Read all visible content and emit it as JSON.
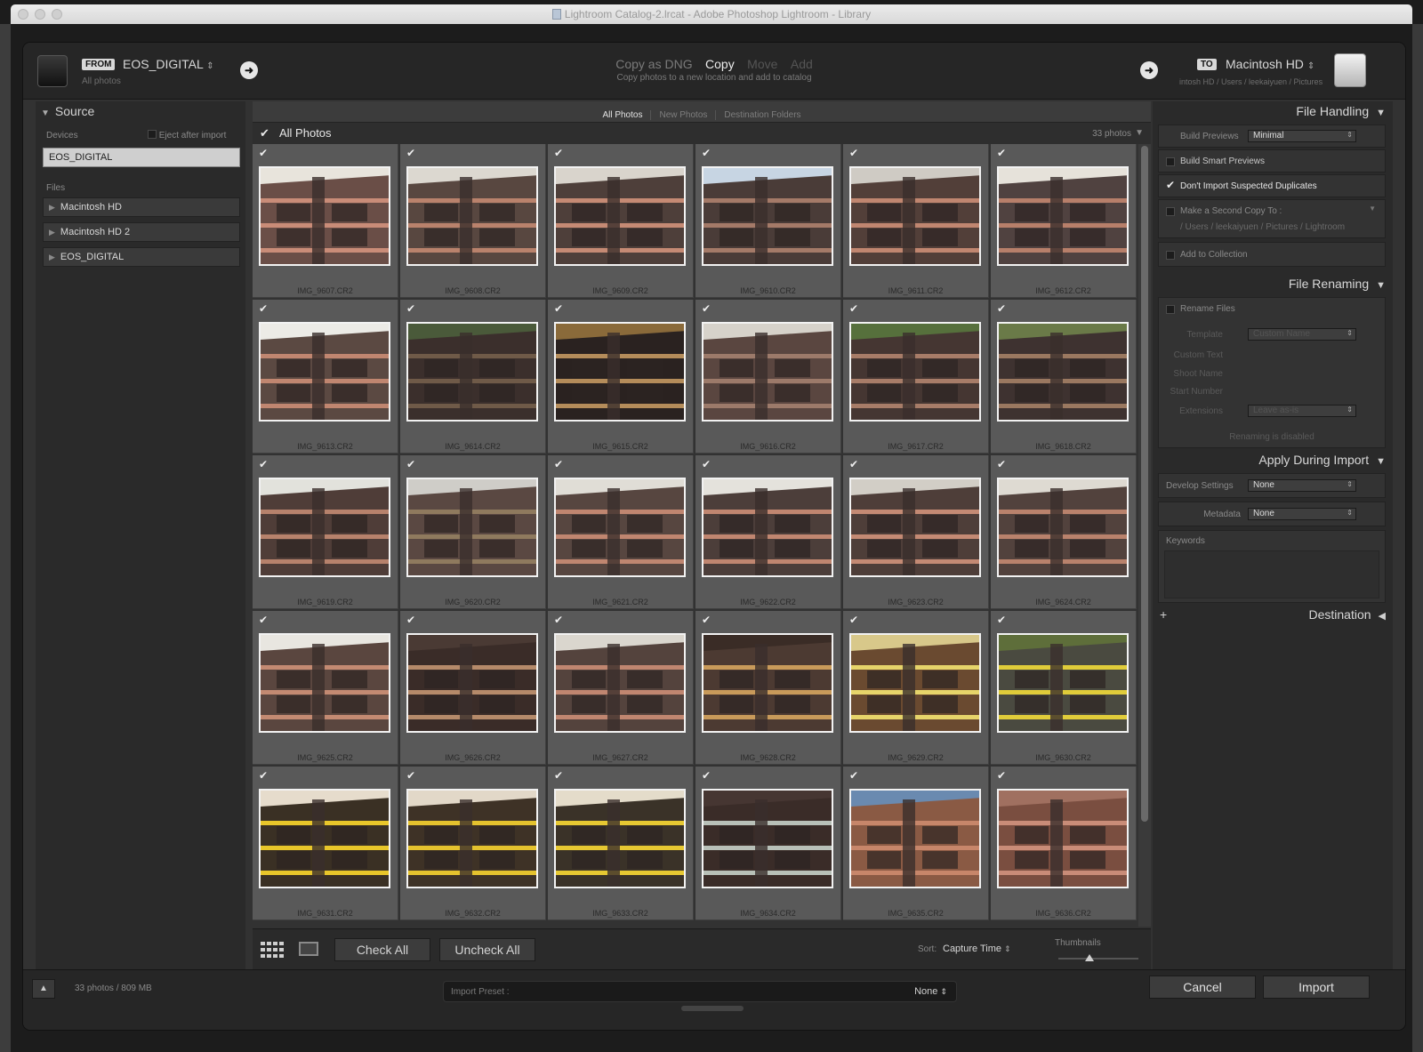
{
  "window": {
    "title": "Lightroom Catalog-2.lrcat - Adobe Photoshop Lightroom - Library"
  },
  "header": {
    "from_badge": "FROM",
    "source_name": "EOS_DIGITAL",
    "source_sub": "All photos",
    "modes": [
      "Copy as DNG",
      "Copy",
      "Move",
      "Add"
    ],
    "active_mode": "Copy",
    "mode_description": "Copy photos to a new location and add to catalog",
    "to_badge": "TO",
    "dest_name": "Macintosh HD",
    "dest_path": "intosh HD / Users / leekaiyuen / Pictures"
  },
  "source_panel": {
    "title": "Source",
    "devices_label": "Devices",
    "eject_label": "Eject after import",
    "selected_device": "EOS_DIGITAL",
    "files_label": "Files",
    "file_items": [
      "Macintosh HD",
      "Macintosh HD 2",
      "EOS_DIGITAL"
    ]
  },
  "filter_bar": {
    "tabs": [
      "All Photos",
      "New Photos",
      "Destination Folders"
    ],
    "active": "All Photos"
  },
  "grid": {
    "title": "All Photos",
    "count_label": "33 photos",
    "photos": [
      {
        "name": "IMG_9607.CR2",
        "sky": "#e8e4dc",
        "wall": "#6a4e47",
        "accent": "#c98c78"
      },
      {
        "name": "IMG_9608.CR2",
        "sky": "#dcd8d0",
        "wall": "#584740",
        "accent": "#b9826c"
      },
      {
        "name": "IMG_9609.CR2",
        "sky": "#d9d4cc",
        "wall": "#4e3f3a",
        "accent": "#c58a74"
      },
      {
        "name": "IMG_9610.CR2",
        "sky": "#c7d5e3",
        "wall": "#4a3c38",
        "accent": "#a47a68"
      },
      {
        "name": "IMG_9611.CR2",
        "sky": "#cfcbc4",
        "wall": "#523f39",
        "accent": "#c08670"
      },
      {
        "name": "IMG_9612.CR2",
        "sky": "#e6e2da",
        "wall": "#504240",
        "accent": "#b77f6a"
      },
      {
        "name": "IMG_9613.CR2",
        "sky": "#ecebe6",
        "wall": "#5b4942",
        "accent": "#c08670"
      },
      {
        "name": "IMG_9614.CR2",
        "sky": "#4a5a3a",
        "wall": "#3b2f2c",
        "accent": "#6f5a48"
      },
      {
        "name": "IMG_9615.CR2",
        "sky": "#8a6a3a",
        "wall": "#2a2220",
        "accent": "#b48c5a"
      },
      {
        "name": "IMG_9616.CR2",
        "sky": "#d6d2ca",
        "wall": "#5a4640",
        "accent": "#9c7a6a"
      },
      {
        "name": "IMG_9617.CR2",
        "sky": "#56703c",
        "wall": "#453632",
        "accent": "#a77c68"
      },
      {
        "name": "IMG_9618.CR2",
        "sky": "#6a7a48",
        "wall": "#3e3230",
        "accent": "#9a7860"
      },
      {
        "name": "IMG_9619.CR2",
        "sky": "#e2e2dc",
        "wall": "#4f3d38",
        "accent": "#b7826c"
      },
      {
        "name": "IMG_9620.CR2",
        "sky": "#cfcdc8",
        "wall": "#5a4842",
        "accent": "#8f7a5e"
      },
      {
        "name": "IMG_9621.CR2",
        "sky": "#e0ddd6",
        "wall": "#574640",
        "accent": "#c08670"
      },
      {
        "name": "IMG_9622.CR2",
        "sky": "#e4e2dc",
        "wall": "#4c3e3a",
        "accent": "#c08670"
      },
      {
        "name": "IMG_9623.CR2",
        "sky": "#d2cec6",
        "wall": "#4e3e39",
        "accent": "#c48a74"
      },
      {
        "name": "IMG_9624.CR2",
        "sky": "#dedad2",
        "wall": "#52423d",
        "accent": "#b9826c"
      },
      {
        "name": "IMG_9625.CR2",
        "sky": "#e8e6e0",
        "wall": "#5a463f",
        "accent": "#c38a72"
      },
      {
        "name": "IMG_9626.CR2",
        "sky": "#4a3a34",
        "wall": "#3a2c28",
        "accent": "#b58a6a"
      },
      {
        "name": "IMG_9627.CR2",
        "sky": "#dad6ce",
        "wall": "#54433d",
        "accent": "#c08670"
      },
      {
        "name": "IMG_9628.CR2",
        "sky": "#3a2c26",
        "wall": "#4c3a32",
        "accent": "#c89a5a"
      },
      {
        "name": "IMG_9629.CR2",
        "sky": "#d8c88a",
        "wall": "#6a4a30",
        "accent": "#e6d46a"
      },
      {
        "name": "IMG_9630.CR2",
        "sky": "#5e6e3a",
        "wall": "#4a4a40",
        "accent": "#e0cc3a"
      },
      {
        "name": "IMG_9631.CR2",
        "sky": "#e6dccc",
        "wall": "#3a3024",
        "accent": "#e8c62a"
      },
      {
        "name": "IMG_9632.CR2",
        "sky": "#e2d8c8",
        "wall": "#3e3226",
        "accent": "#e4c22e"
      },
      {
        "name": "IMG_9633.CR2",
        "sky": "#e4dcca",
        "wall": "#3a3228",
        "accent": "#e6c832"
      },
      {
        "name": "IMG_9634.CR2",
        "sky": "#463632",
        "wall": "#3a2c28",
        "accent": "#b8c0b8"
      },
      {
        "name": "IMG_9635.CR2",
        "sky": "#6a8ab0",
        "wall": "#8a5a44",
        "accent": "#c7866a"
      },
      {
        "name": "IMG_9636.CR2",
        "sky": "#a07060",
        "wall": "#7a4e40",
        "accent": "#c98c78"
      }
    ]
  },
  "grid_toolbar": {
    "check_all": "Check All",
    "uncheck_all": "Uncheck All",
    "sort_label": "Sort:",
    "sort_value": "Capture Time",
    "thumbnails_label": "Thumbnails"
  },
  "right_panel": {
    "file_handling": {
      "title": "File Handling",
      "build_previews_label": "Build Previews",
      "build_previews_value": "Minimal",
      "build_smart_previews": "Build Smart Previews",
      "dont_import_duplicates": "Don't Import Suspected Duplicates",
      "second_copy": "Make a Second Copy To :",
      "second_copy_path": "/ Users / leekaiyuen / Pictures / Lightroom",
      "add_to_collection": "Add to Collection"
    },
    "file_renaming": {
      "title": "File Renaming",
      "rename_files": "Rename Files",
      "template_label": "Template",
      "template_value": "Custom Name",
      "custom_text_label": "Custom Text",
      "shoot_name_label": "Shoot Name",
      "start_number_label": "Start Number",
      "extensions_label": "Extensions",
      "extensions_value": "Leave as-is",
      "disabled_note": "Renaming is disabled"
    },
    "apply_during_import": {
      "title": "Apply During Import",
      "develop_label": "Develop Settings",
      "develop_value": "None",
      "metadata_label": "Metadata",
      "metadata_value": "None",
      "keywords_label": "Keywords"
    },
    "destination": {
      "title": "Destination",
      "plus": "+"
    }
  },
  "footer": {
    "count": "33 photos / 809 MB",
    "preset_label": "Import Preset :",
    "preset_value": "None",
    "cancel": "Cancel",
    "import": "Import"
  }
}
